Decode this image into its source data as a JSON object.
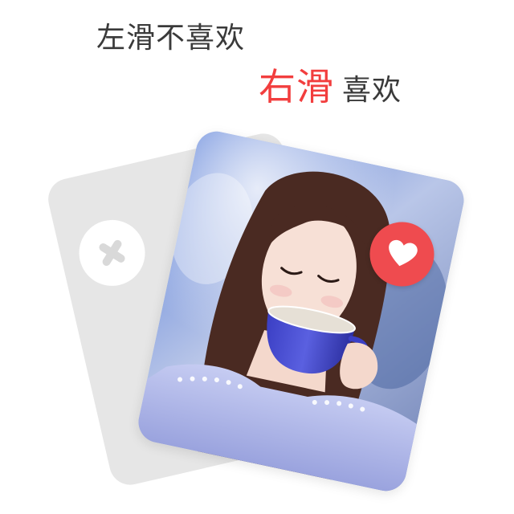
{
  "instructions": {
    "swipe_left_text": "左滑不喜欢",
    "swipe_right_highlight": "右滑",
    "swipe_right_text": "喜欢"
  },
  "cards": {
    "dislike_icon": "close-icon",
    "like_icon": "heart-icon",
    "photo_subject": "woman-drinking-from-blue-cup"
  },
  "colors": {
    "accent_red": "#f23e3e",
    "like_button": "#ef4b4f",
    "back_card": "#e6e6e6",
    "text": "#3a3a3a"
  }
}
